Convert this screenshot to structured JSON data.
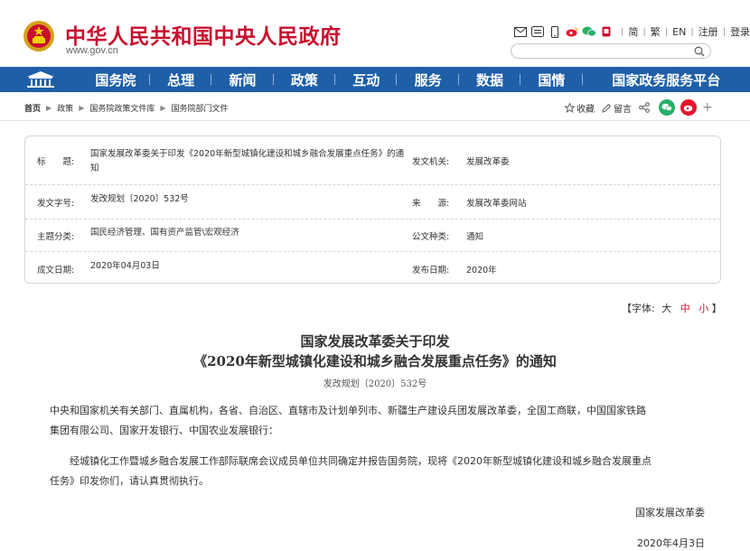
{
  "header": {
    "site_title": "中华人民共和国中央人民政府",
    "site_url": "www.gov.cn",
    "lang_simplified": "简",
    "lang_traditional": "繁",
    "lang_en": "EN",
    "register": "注册",
    "login": "登录",
    "search_placeholder": ""
  },
  "nav": {
    "items": [
      "国务院",
      "总理",
      "新闻",
      "政策",
      "互动",
      "服务",
      "数据",
      "国情",
      "国家政务服务平台"
    ]
  },
  "breadcrumb": [
    "首页",
    "政策",
    "国务院政策文件库",
    "国务院部门文件"
  ],
  "tools": {
    "favorite": "收藏",
    "comment": "留言"
  },
  "info": {
    "title_label": "标　　题:",
    "title_value": "国家发展改革委关于印发《2020年新型城镇化建设和城乡融合发展重点任务》的通知",
    "issuer_label": "发文机关:",
    "issuer_value": "发展改革委",
    "docno_label": "发文字号:",
    "docno_value": "发改规划〔2020〕532号",
    "source_label": "来　　源:",
    "source_value": "发展改革委网站",
    "topic_label": "主题分类:",
    "topic_value": "国民经济管理、国有资产监管\\宏观经济",
    "kind_label": "公文种类:",
    "kind_value": "通知",
    "written_label": "成文日期:",
    "written_value": "2020年04月03日",
    "published_label": "发布日期:",
    "published_value": "2020年"
  },
  "fontsize": {
    "prefix": "【字体:",
    "large": "大",
    "medium": "中",
    "small": "小",
    "suffix": "】"
  },
  "article": {
    "title_line1": "国家发展改革委关于印发",
    "title_line2": "《2020年新型城镇化建设和城乡融合发展重点任务》的通知",
    "doc_no": "发改规划〔2020〕532号",
    "recipients_line1": "中央和国家机关有关部门、直属机构，各省、自治区、直辖市及计划单列市、新疆生产建设兵团发展改革委，全国工商联，中国国家铁路",
    "recipients_line2": "集团有限公司、国家开发银行、中国农业发展银行：",
    "body_line1": "　　经城镇化工作暨城乡融合发展工作部际联席会议成员单位共同确定并报告国务院，现将《2020年新型城镇化建设和城乡融合发展重点",
    "body_line2": "任务》印发你们，请认真贯彻执行。",
    "signature": "国家发展改革委",
    "date": "2020年4月3日"
  },
  "colors": {
    "brand_red": "#c8102e",
    "nav_blue": "#1e5fa8"
  }
}
